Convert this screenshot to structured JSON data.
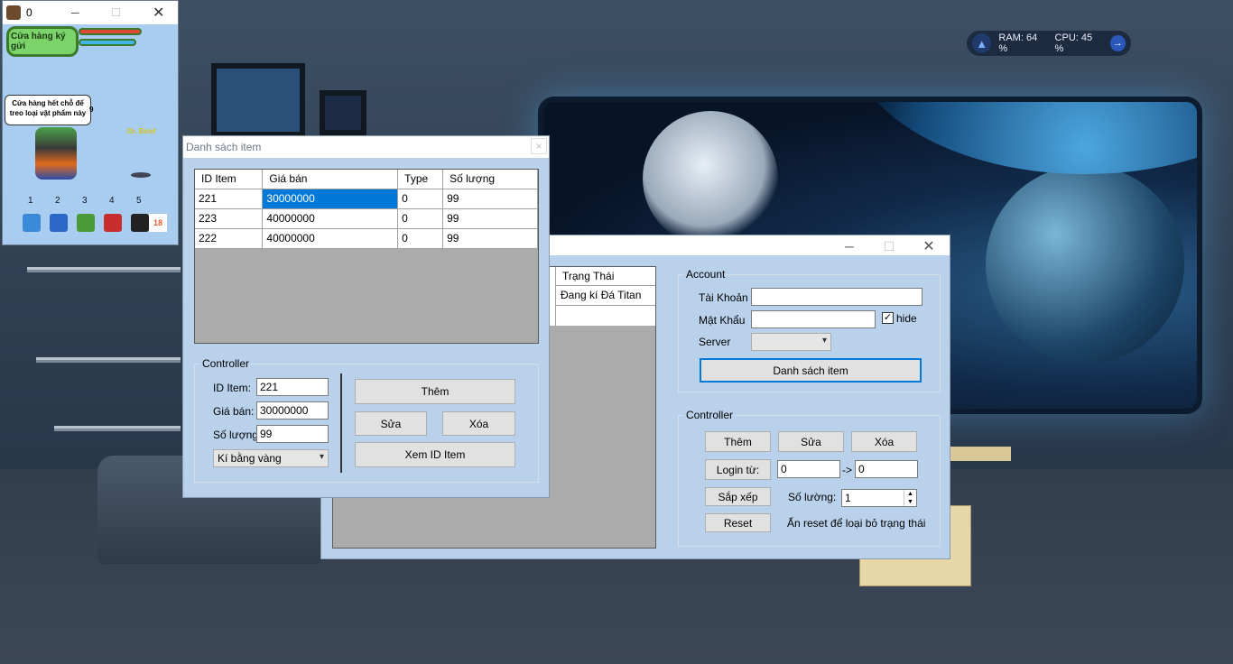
{
  "sysmon": {
    "ram": "RAM: 64 %",
    "cpu": "CPU: 45 %"
  },
  "game": {
    "title": "0",
    "shop_name": "Cửa hàng ký gửi",
    "bubble": "Cửa hàng hết chỗ để treo loại vật phẩm này",
    "npc_name": "Dr. Brief",
    "side_number": "9",
    "slots": [
      "1",
      "2",
      "3",
      "4",
      "5"
    ],
    "slot_count": "18"
  },
  "item_window": {
    "title": "Danh sách item",
    "close_glyph": "×",
    "columns": [
      "ID Item",
      "Giá bán",
      "Type",
      "Số lượng"
    ],
    "rows": [
      [
        "221",
        "30000000",
        "0",
        "99"
      ],
      [
        "223",
        "40000000",
        "0",
        "99"
      ],
      [
        "222",
        "40000000",
        "0",
        "99"
      ]
    ],
    "controller": {
      "group_label": "Controller",
      "id_label": "ID Item:",
      "id_value": "221",
      "price_label": "Giá bán:",
      "price_value": "30000000",
      "qty_label": "Số lượng:",
      "qty_value": "99",
      "type_select": "Kí bằng vàng",
      "add_button": "Thêm",
      "edit_button": "Sửa",
      "delete_button": "Xóa",
      "view_button": "Xem ID Item"
    }
  },
  "main_window": {
    "grid_header": "Trạng Thái",
    "grid_row": "Đang kí Đá Titan",
    "account": {
      "group_label": "Account",
      "user_label": "Tài Khoản",
      "user_value": "",
      "pass_label": "Mật Khẩu",
      "pass_value": "",
      "hide_label": "hide",
      "hide_checked": true,
      "server_label": "Server",
      "server_value": "",
      "list_button": "Danh sách item"
    },
    "controller": {
      "group_label": "Controller",
      "add_button": "Thêm",
      "edit_button": "Sửa",
      "delete_button": "Xóa",
      "login_button": "Login từ:",
      "login_from": "0",
      "arrow": "->",
      "login_to": "0",
      "sort_button": "Sắp xếp",
      "count_label": "Số lường:",
      "count_value": "1",
      "reset_button": "Reset",
      "reset_hint": "Ấn reset để loại bỏ trạng thái"
    }
  }
}
